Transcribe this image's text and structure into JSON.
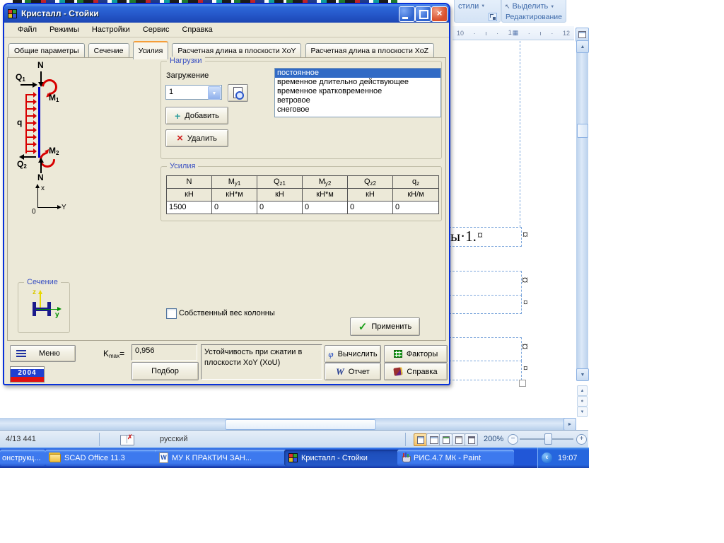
{
  "icons": {
    "close": "×",
    "check": "✓",
    "add": "+",
    "remove": "×",
    "phi": "φ",
    "w": "W",
    "dropdown": "▼",
    "combo_arrow": "▼",
    "scroll_up": "▲",
    "scroll_down": "▼",
    "scroll_right": "►",
    "browse_up": "▲",
    "browse_ball": "●",
    "browse_down": "▼",
    "chevron_left": "‹",
    "zoom_minus": "−",
    "zoom_plus": "+",
    "cell_marker": "¤",
    "pointer": "↖",
    "spell_x": "✗",
    "ruler_dot": "·",
    "ruler_tick": "ı",
    "ruler_grid": "▦"
  },
  "word": {
    "ribbon": {
      "styles": "стили",
      "select": "Выделить",
      "editing": "Редактирование"
    },
    "ruler": {
      "n10": "10",
      "n11": "1",
      "n12": "12"
    },
    "document": {
      "text_fragment": "ы·1."
    },
    "statusbar": {
      "page_info": "4/13 441",
      "language": "русский",
      "zoom_level": "200%"
    }
  },
  "kristall": {
    "title": "Кристалл - Стойки",
    "menu": [
      "Файл",
      "Режимы",
      "Настройки",
      "Сервис",
      "Справка"
    ],
    "tabs": [
      "Общие параметры",
      "Сечение",
      "Усилия",
      "Расчетная длина в плоскости XoY",
      "Расчетная длина в плоскости XoZ"
    ],
    "active_tab_index": 2,
    "diagram": {
      "n_top": "N",
      "q1b": "Q",
      "q1s": "1",
      "m1b": "M",
      "m1s": "1",
      "q": "q",
      "m2b": "M",
      "m2s": "2",
      "q2b": "Q",
      "q2s": "2",
      "n_bottom": "N",
      "axis_x": "x",
      "axis_y": "Y",
      "origin": "0"
    },
    "section": {
      "label": "Сечение",
      "z": "z",
      "y": "y"
    },
    "loads": {
      "label": "Нагрузки",
      "loading": "Загружение",
      "value": "1",
      "items": [
        "постоянное",
        "временное длительно действующее",
        "временное кратковременное",
        "ветровое",
        "снеговое"
      ],
      "selected_index": 0,
      "add": "Добавить",
      "remove": "Удалить"
    },
    "forces": {
      "label": "Усилия",
      "cols": [
        {
          "b": "N",
          "s": ""
        },
        {
          "b": "M",
          "s": "y1"
        },
        {
          "b": "Q",
          "s": "z1"
        },
        {
          "b": "M",
          "s": "y2"
        },
        {
          "b": "Q",
          "s": "z2"
        },
        {
          "b": "q",
          "s": "z"
        }
      ],
      "units": [
        "кН",
        "кН*м",
        "кН",
        "кН*м",
        "кН",
        "кН/м"
      ],
      "values": [
        "1500",
        "0",
        "0",
        "0",
        "0",
        "0"
      ]
    },
    "self_weight": "Собственный вес колонны",
    "apply": "Применить",
    "footer": {
      "menu": "Меню",
      "badge": "2004",
      "kb": "K",
      "ks": "max",
      "keq": "=",
      "kval": "0,956",
      "podbor": "Подбор",
      "info": "Устойчивость при сжатии в плоскости XoY (XoU)",
      "compute": "Вычислить",
      "factors": "Факторы",
      "report": "Отчет",
      "help": "Справка"
    }
  },
  "taskbar": {
    "buttons": [
      "онструкц...",
      "SCAD Office 11.3",
      "МУ К ПРАКТИЧ ЗАН...",
      "Кристалл - Стойки",
      "РИС.4.7 МК - Paint"
    ],
    "active_index": 3,
    "clock": "19:07"
  },
  "colors": {
    "selection": "#316AC5",
    "titlebar": "#2456C8",
    "taskbar": "#245EDB",
    "tab_accent": "#F59D38"
  }
}
